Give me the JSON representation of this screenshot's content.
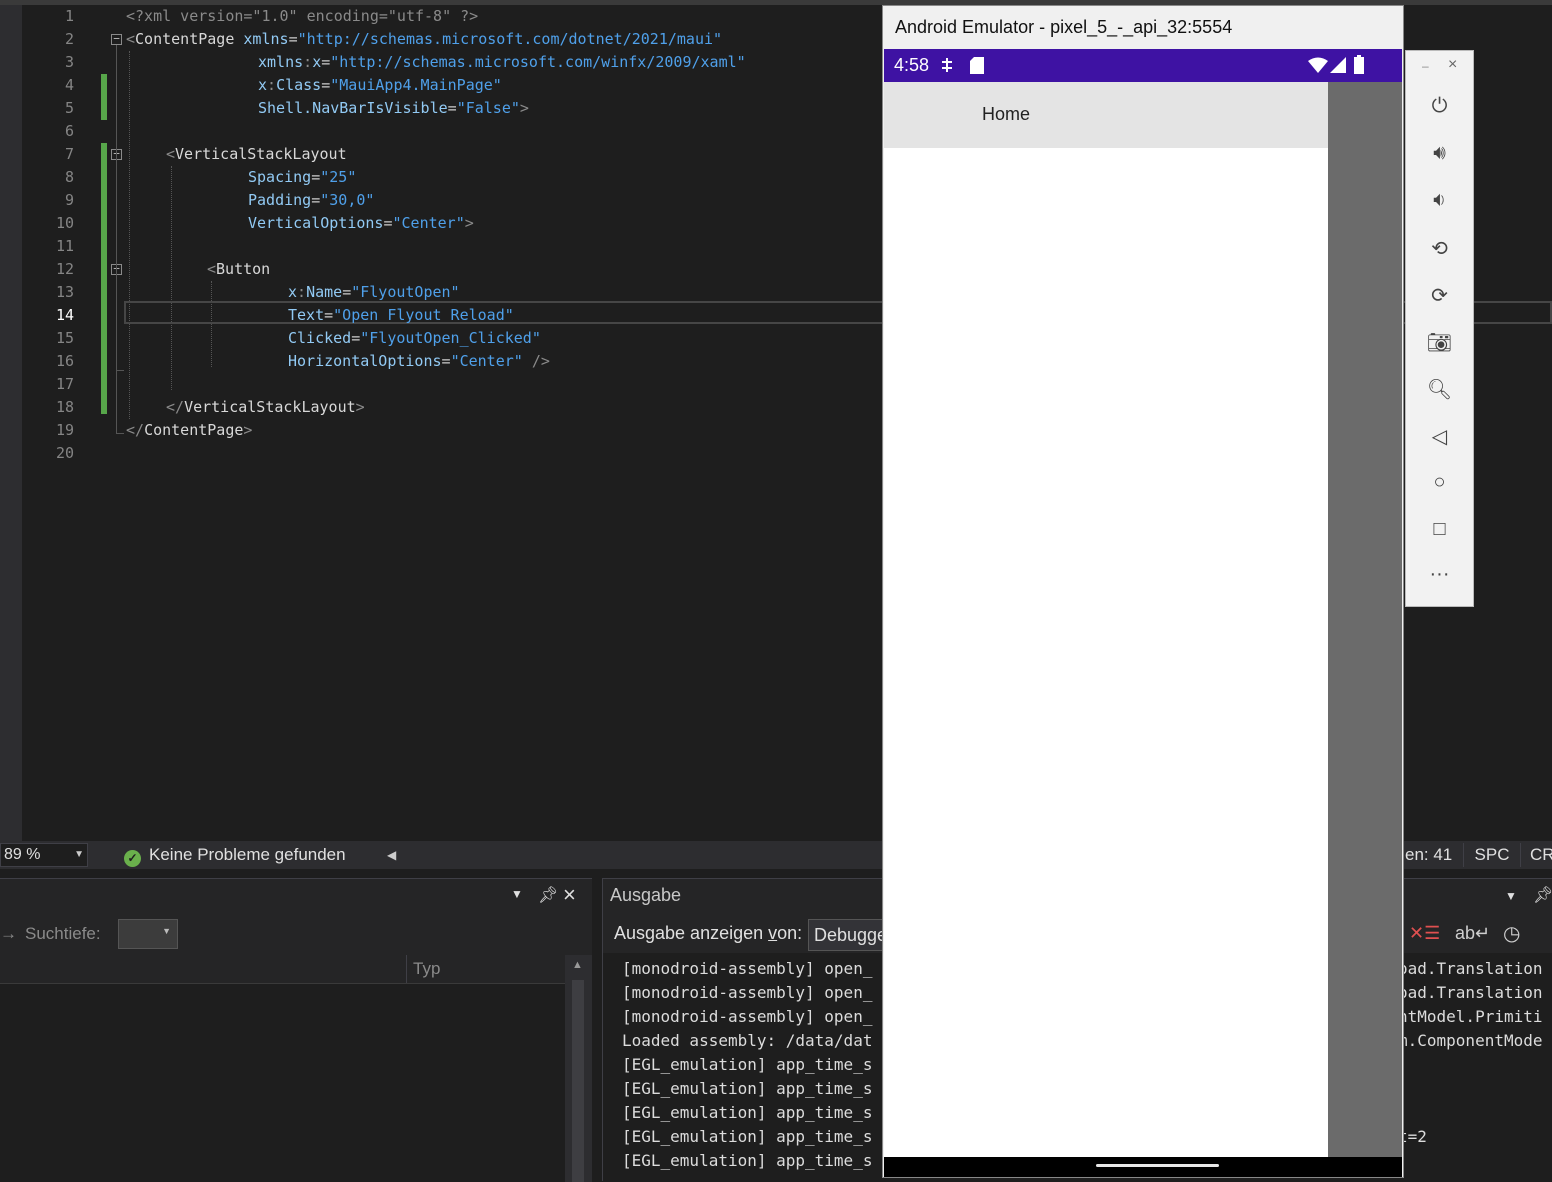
{
  "editor": {
    "line_numbers": [
      "1",
      "2",
      "3",
      "4",
      "5",
      "6",
      "7",
      "8",
      "9",
      "10",
      "11",
      "12",
      "13",
      "14",
      "15",
      "16",
      "17",
      "18",
      "19",
      "20"
    ],
    "current_line": "14",
    "code": {
      "l1": "<?xml version=\"1.0\" encoding=\"utf-8\" ?>",
      "l2_tag": "ContentPage",
      "l2_attr": "xmlns",
      "l2_val": "\"http://schemas.microsoft.com/dotnet/2021/maui\"",
      "l3_attr": "xmlns",
      "l3_attr2": "x",
      "l3_val": "\"http://schemas.microsoft.com/winfx/2009/xaml\"",
      "l4_attr": "x",
      "l4_attr2": "Class",
      "l4_val": "\"MauiApp4.MainPage\"",
      "l5_attr": "Shell.NavBarIsVisible",
      "l5_val": "\"False\"",
      "l7_tag": "VerticalStackLayout",
      "l8_attr": "Spacing",
      "l8_val": "\"25\"",
      "l9_attr": "Padding",
      "l9_val": "\"30,0\"",
      "l10_attr": "VerticalOptions",
      "l10_val": "\"Center\"",
      "l12_tag": "Button",
      "l13_attr": "x",
      "l13_attr2": "Name",
      "l13_val": "\"FlyoutOpen\"",
      "l14_attr": "Text",
      "l14_val": "\"Open Flyout Reload\"",
      "l15_attr": "Clicked",
      "l15_val": "\"FlyoutOpen_Clicked\"",
      "l16_attr": "HorizontalOptions",
      "l16_val": "\"Center\"",
      "l18_tag": "VerticalStackLayout",
      "l19_tag": "ContentPage"
    }
  },
  "statusbar": {
    "zoom": "89 %",
    "issues": "Keine Probleme gefunden",
    "column": "en: 41",
    "spc": "SPC",
    "crlf": "CR"
  },
  "left_panel": {
    "search_depth_label": "Suchtiefe:",
    "col_typ": "Typ"
  },
  "output": {
    "title": "Ausgabe",
    "show_from_prefix": "Ausgabe anzeigen ",
    "show_from_key": "v",
    "show_from_suffix": "on:",
    "source": "Debugge",
    "lines": [
      "[monodroid-assembly] open_",
      "[monodroid-assembly] open_",
      "[monodroid-assembly] open_",
      "Loaded assembly: /data/dat",
      "[EGL_emulation] app_time_s",
      "[EGL_emulation] app_time_s",
      "[EGL_emulation] app_time_s",
      "[EGL_emulation] app_time_s",
      "[EGL_emulation] app_time_s"
    ],
    "lines_right": [
      "oad.Translation",
      "oad.Translation",
      "ntModel.Primiti",
      "m.ComponentMode",
      "",
      "",
      "",
      "t=2",
      ""
    ]
  },
  "emulator": {
    "title": "Android Emulator - pixel_5_-_api_32:5554",
    "clock": "4:58",
    "nav_title": "Home"
  },
  "emulator_toolbar": {
    "minimize": "–",
    "close": "×"
  }
}
